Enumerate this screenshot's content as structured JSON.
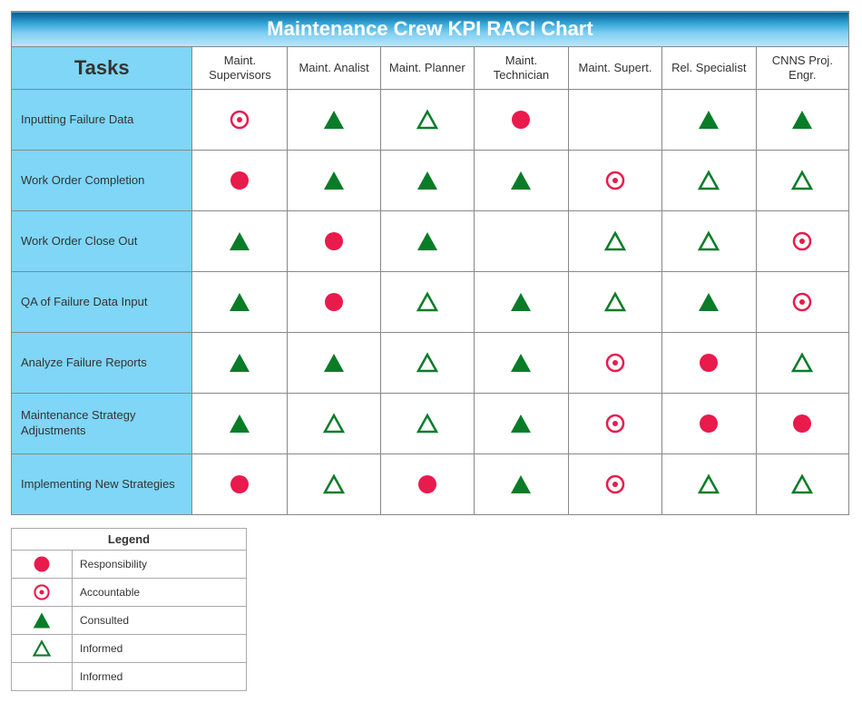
{
  "title": "Maintenance Crew KPI RACI Chart",
  "tasks_header": "Tasks",
  "roles": [
    "Maint. Supervisors",
    "Maint. Analist",
    "Maint. Planner",
    "Maint. Technician",
    "Maint. Supert.",
    "Rel. Specialist",
    "CNNS Proj. Engr."
  ],
  "tasks": [
    "Inputting Failure Data",
    "Work Order Completion",
    "Work Order Close Out",
    "QA of Failure Data Input",
    "Analyze Failure Reports",
    "Maintenance Strategy Adjustments",
    "Implementing New Strategies"
  ],
  "matrix": [
    [
      "A",
      "C",
      "I",
      "R",
      "",
      "C",
      "C"
    ],
    [
      "R",
      "C",
      "C",
      "C",
      "A",
      "I",
      "I"
    ],
    [
      "C",
      "R",
      "C",
      "",
      "I",
      "I",
      "A"
    ],
    [
      "C",
      "R",
      "I",
      "C",
      "I",
      "C",
      "A"
    ],
    [
      "C",
      "C",
      "I",
      "C",
      "A",
      "R",
      "I"
    ],
    [
      "C",
      "I",
      "I",
      "C",
      "A",
      "R",
      "R"
    ],
    [
      "R",
      "I",
      "R",
      "C",
      "A",
      "I",
      "I"
    ]
  ],
  "legend_title": "Legend",
  "legend_items": [
    {
      "symbol": "R",
      "label": "Responsibility"
    },
    {
      "symbol": "A",
      "label": "Accountable"
    },
    {
      "symbol": "C",
      "label": "Consulted"
    },
    {
      "symbol": "I",
      "label": "Informed"
    },
    {
      "symbol": "",
      "label": "Informed"
    }
  ],
  "colors": {
    "red": "#e91a4c",
    "green": "#0a7c28"
  }
}
